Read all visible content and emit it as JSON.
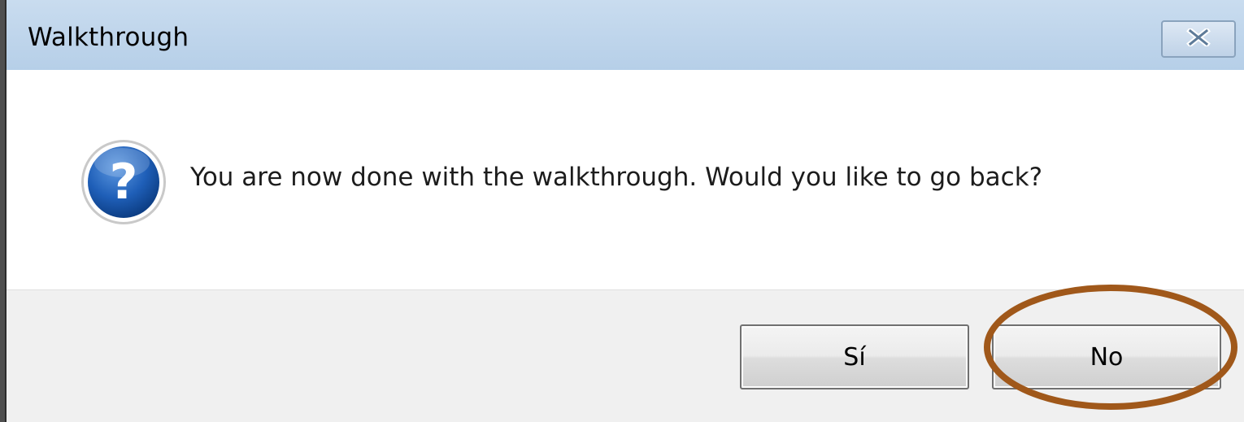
{
  "window": {
    "title": "Walkthrough",
    "close_icon": "close-icon"
  },
  "message": {
    "icon": "question-icon",
    "text": "You are now done with the walkthrough.  Would you like to go back?"
  },
  "buttons": {
    "yes_label": "Sí",
    "no_label": "No"
  },
  "annotation": {
    "highlight": "no-button",
    "color": "#a0581a"
  }
}
